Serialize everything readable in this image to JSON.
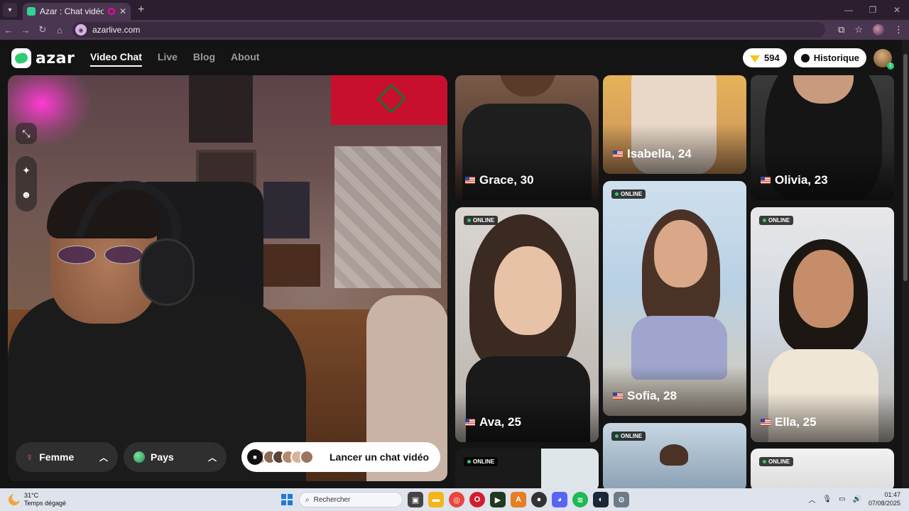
{
  "browser": {
    "tab_title": "Azar : Chat vidéo avec de n",
    "url": "azarlive.com"
  },
  "header": {
    "logo_text": "azar",
    "nav": [
      {
        "label": "Video Chat",
        "active": true
      },
      {
        "label": "Live",
        "active": false
      },
      {
        "label": "Blog",
        "active": false
      },
      {
        "label": "About",
        "active": false
      }
    ],
    "gems": "594",
    "history_label": "Historique",
    "avatar_badge": "1"
  },
  "controls": {
    "gender_label": "Femme",
    "country_label": "Pays",
    "launch_label": "Lancer un chat vidéo"
  },
  "online_label": "ONLINE",
  "profiles": {
    "grace": "Grace, 30",
    "isabella": "Isabella, 24",
    "olivia": "Olivia, 23",
    "ava": "Ava, 25",
    "sofia": "Sofia, 28",
    "ella": "Ella, 25"
  },
  "taskbar": {
    "temperature": "31°C",
    "weather": "Temps dégagé",
    "search_placeholder": "Rechercher",
    "time": "01:47",
    "date": "07/08/2025"
  },
  "colors": {
    "brand_green": "#2ecc71",
    "online_dot": "#2ecc71",
    "browser_chrome": "#4a3650"
  }
}
